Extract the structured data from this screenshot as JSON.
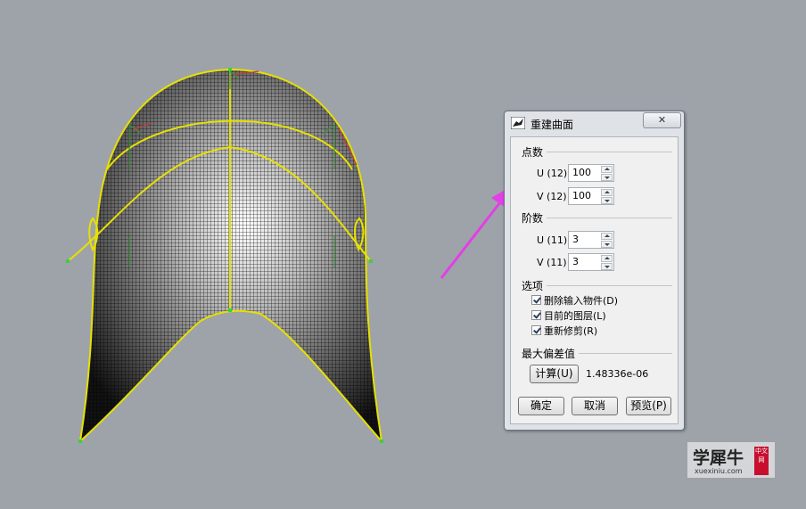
{
  "dialog": {
    "title": "重建曲面",
    "close_glyph": "✕",
    "sections": {
      "points": {
        "label": "点数",
        "u_label": "U (12)",
        "u_value": "100",
        "v_label": "V (12)",
        "v_value": "100"
      },
      "degree": {
        "label": "阶数",
        "u_label": "U (11)",
        "u_value": "3",
        "v_label": "V (11)",
        "v_value": "3"
      },
      "options": {
        "label": "选项",
        "items": [
          {
            "label": "删除输入物件(D)",
            "checked": true
          },
          {
            "label": "目前的图层(L)",
            "checked": true
          },
          {
            "label": "重新修剪(R)",
            "checked": true
          }
        ]
      },
      "max_deviation": {
        "label": "最大偏差值",
        "compute_button": "计算(U)",
        "value": "1.48336e-06"
      }
    },
    "buttons": {
      "ok": "确定",
      "cancel": "取消",
      "preview": "预览(P)"
    }
  },
  "watermark": {
    "main": "学犀牛",
    "sub": "xuexiniu.com",
    "badge": "中文网"
  },
  "colors": {
    "viewport_bg": "#9ea3a9",
    "curve_yellow": "#e7e000",
    "highlight_magenta": "#e23fe6",
    "point_green": "#39d13a"
  },
  "icons": {
    "app": "rhino-icon",
    "close": "close-icon",
    "spin_up": "chevron-up-icon",
    "spin_down": "chevron-down-icon",
    "arrow": "arrow-annotation-icon"
  }
}
